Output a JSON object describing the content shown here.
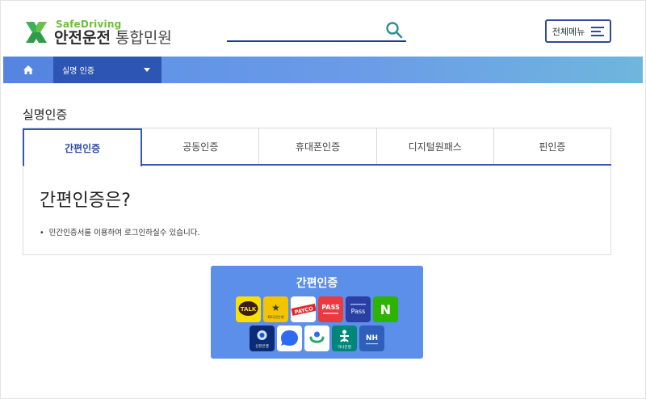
{
  "header": {
    "logo_en": "SafeDriving",
    "logo_kr": "안전운전",
    "logo_sub": "통합민원",
    "search_placeholder": "",
    "menu_label": "전체메뉴"
  },
  "nav": {
    "breadcrumb_current": "실명 인증"
  },
  "page": {
    "title": "실명인증",
    "tabs": [
      {
        "label": "간편인증",
        "active": true
      },
      {
        "label": "공동인증",
        "active": false
      },
      {
        "label": "휴대폰인증",
        "active": false
      },
      {
        "label": "디지털원패스",
        "active": false
      },
      {
        "label": "핀인증",
        "active": false
      }
    ],
    "info": {
      "heading": "간편인증은?",
      "bullet": "민간인증서를 이용하여 로그인하실수 있습니다."
    }
  },
  "auth_panel": {
    "title": "간편인증",
    "providers_row1": [
      {
        "name": "kakao",
        "label": "TALK",
        "bg": "#f9e000",
        "fg": "#3a1d1d"
      },
      {
        "name": "kb",
        "label": "KB국민은행",
        "bg": "#f4c400",
        "fg": "#3b3b3b"
      },
      {
        "name": "payco",
        "label": "PAYCO",
        "bg": "#ffffff",
        "fg": "#e5252a"
      },
      {
        "name": "pass",
        "label": "PASS",
        "bg": "#e83a3f",
        "fg": "#ffffff"
      },
      {
        "name": "samsung-pass",
        "label": "Pass",
        "bg": "#2a3fa3",
        "fg": "#ffffff"
      },
      {
        "name": "naver",
        "label": "N",
        "bg": "#2db400",
        "fg": "#ffffff"
      }
    ],
    "providers_row2": [
      {
        "name": "shinhan",
        "label": "신한은행",
        "bg": "#0b2b74",
        "fg": "#ffffff"
      },
      {
        "name": "toss",
        "label": "",
        "bg": "#ffffff",
        "fg": "#2f6bf2"
      },
      {
        "name": "gov",
        "label": "",
        "bg": "#ffffff",
        "fg": "#2aa86f"
      },
      {
        "name": "hana",
        "label": "하나은행",
        "bg": "#00877a",
        "fg": "#ffffff"
      },
      {
        "name": "nh",
        "label": "NH",
        "bg": "#2f5fb8",
        "fg": "#ffffff"
      }
    ]
  }
}
